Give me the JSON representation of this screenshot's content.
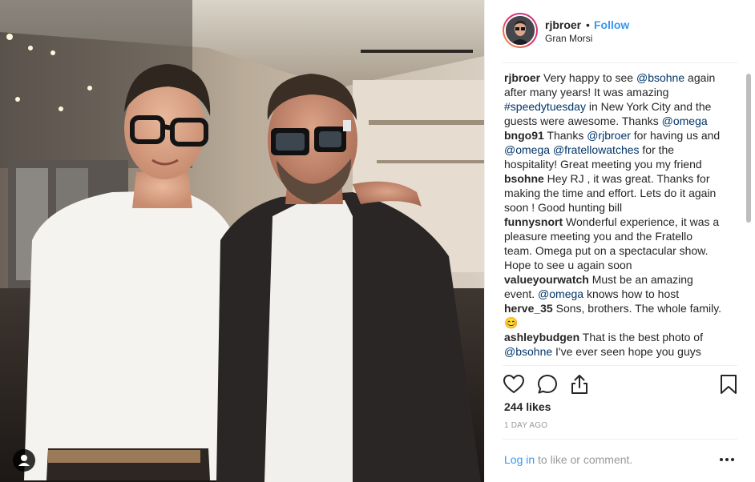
{
  "post": {
    "username": "rjbroer",
    "separator": "•",
    "follow_label": "Follow",
    "location": "Gran Morsi"
  },
  "comments": [
    {
      "user": "rjbroer",
      "parts": [
        {
          "t": " Very happy to see "
        },
        {
          "m": "@bsohne"
        },
        {
          "t": " again after many years! It was amazing "
        },
        {
          "m": "#speedytuesday"
        },
        {
          "t": " in New York City and the guests were awesome. Thanks "
        },
        {
          "m": "@omega"
        }
      ]
    },
    {
      "user": "bngo91",
      "parts": [
        {
          "t": " Thanks "
        },
        {
          "m": "@rjbroer"
        },
        {
          "t": " for having us and "
        },
        {
          "m": "@omega"
        },
        {
          "t": " "
        },
        {
          "m": "@fratellowatches"
        },
        {
          "t": " for the hospitality! Great meeting you my friend"
        }
      ]
    },
    {
      "user": "bsohne",
      "parts": [
        {
          "t": " Hey RJ , it was great. Thanks for making the time and effort. Lets do it again soon ! Good hunting bill"
        }
      ]
    },
    {
      "user": "funnysnort",
      "parts": [
        {
          "t": " Wonderful experience, it was a pleasure meeting you and the Fratello team. Omega put on a spectacular show. Hope to see u again soon"
        }
      ]
    },
    {
      "user": "valueyourwatch",
      "parts": [
        {
          "t": " Must be an amazing event. "
        },
        {
          "m": "@omega"
        },
        {
          "t": " knows how to host"
        }
      ]
    },
    {
      "user": "herve_35",
      "parts": [
        {
          "t": " Sons, brothers. The whole family. "
        },
        {
          "e": "😊"
        }
      ]
    },
    {
      "user": "ashleybudgen",
      "parts": [
        {
          "t": " That is the best photo of "
        },
        {
          "m": "@bsohne"
        },
        {
          "t": " I've ever seen hope you guys"
        }
      ]
    }
  ],
  "actions": {
    "like_icon": "heart-icon",
    "comment_icon": "comment-bubble-icon",
    "share_icon": "share-icon",
    "save_icon": "bookmark-icon"
  },
  "likes_text": "244 likes",
  "timestamp": "1 DAY AGO",
  "footer": {
    "login_link": "Log in",
    "login_suffix": " to like or comment.",
    "more_icon": "more-options-icon"
  },
  "colors": {
    "link_blue": "#3897f0",
    "mention": "#003569",
    "text": "#262626",
    "muted": "#999999"
  }
}
